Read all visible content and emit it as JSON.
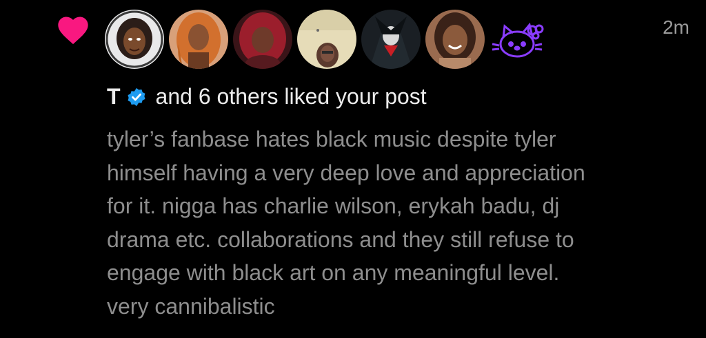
{
  "notification": {
    "type_icon": "heart-icon",
    "timestamp": "2m",
    "liker_name": "T",
    "liker_badge": "verified-icon",
    "liked_text": "and 6 others liked your post",
    "avatars": [
      {
        "label": "avatar-1"
      },
      {
        "label": "avatar-2"
      },
      {
        "label": "avatar-3"
      },
      {
        "label": "avatar-4"
      },
      {
        "label": "avatar-5"
      },
      {
        "label": "avatar-6"
      },
      {
        "label": "avatar-7"
      }
    ]
  },
  "post": {
    "lines": [
      "tyler’s fanbase hates black music despite tyler",
      "himself having a very deep love and appreciation",
      "for it. nigga has charlie wilson, erykah badu, dj",
      "drama etc. collaborations and they still refuse to",
      "engage with black art on any meaningful level.",
      "very cannibalistic"
    ]
  },
  "colors": {
    "background": "#000000",
    "heart": "#f91880",
    "verified": "#1d9bf0",
    "primary_text": "#ececec",
    "secondary_text": "#8e8e8e",
    "hello_kitty_outline": "#8a3cff"
  }
}
